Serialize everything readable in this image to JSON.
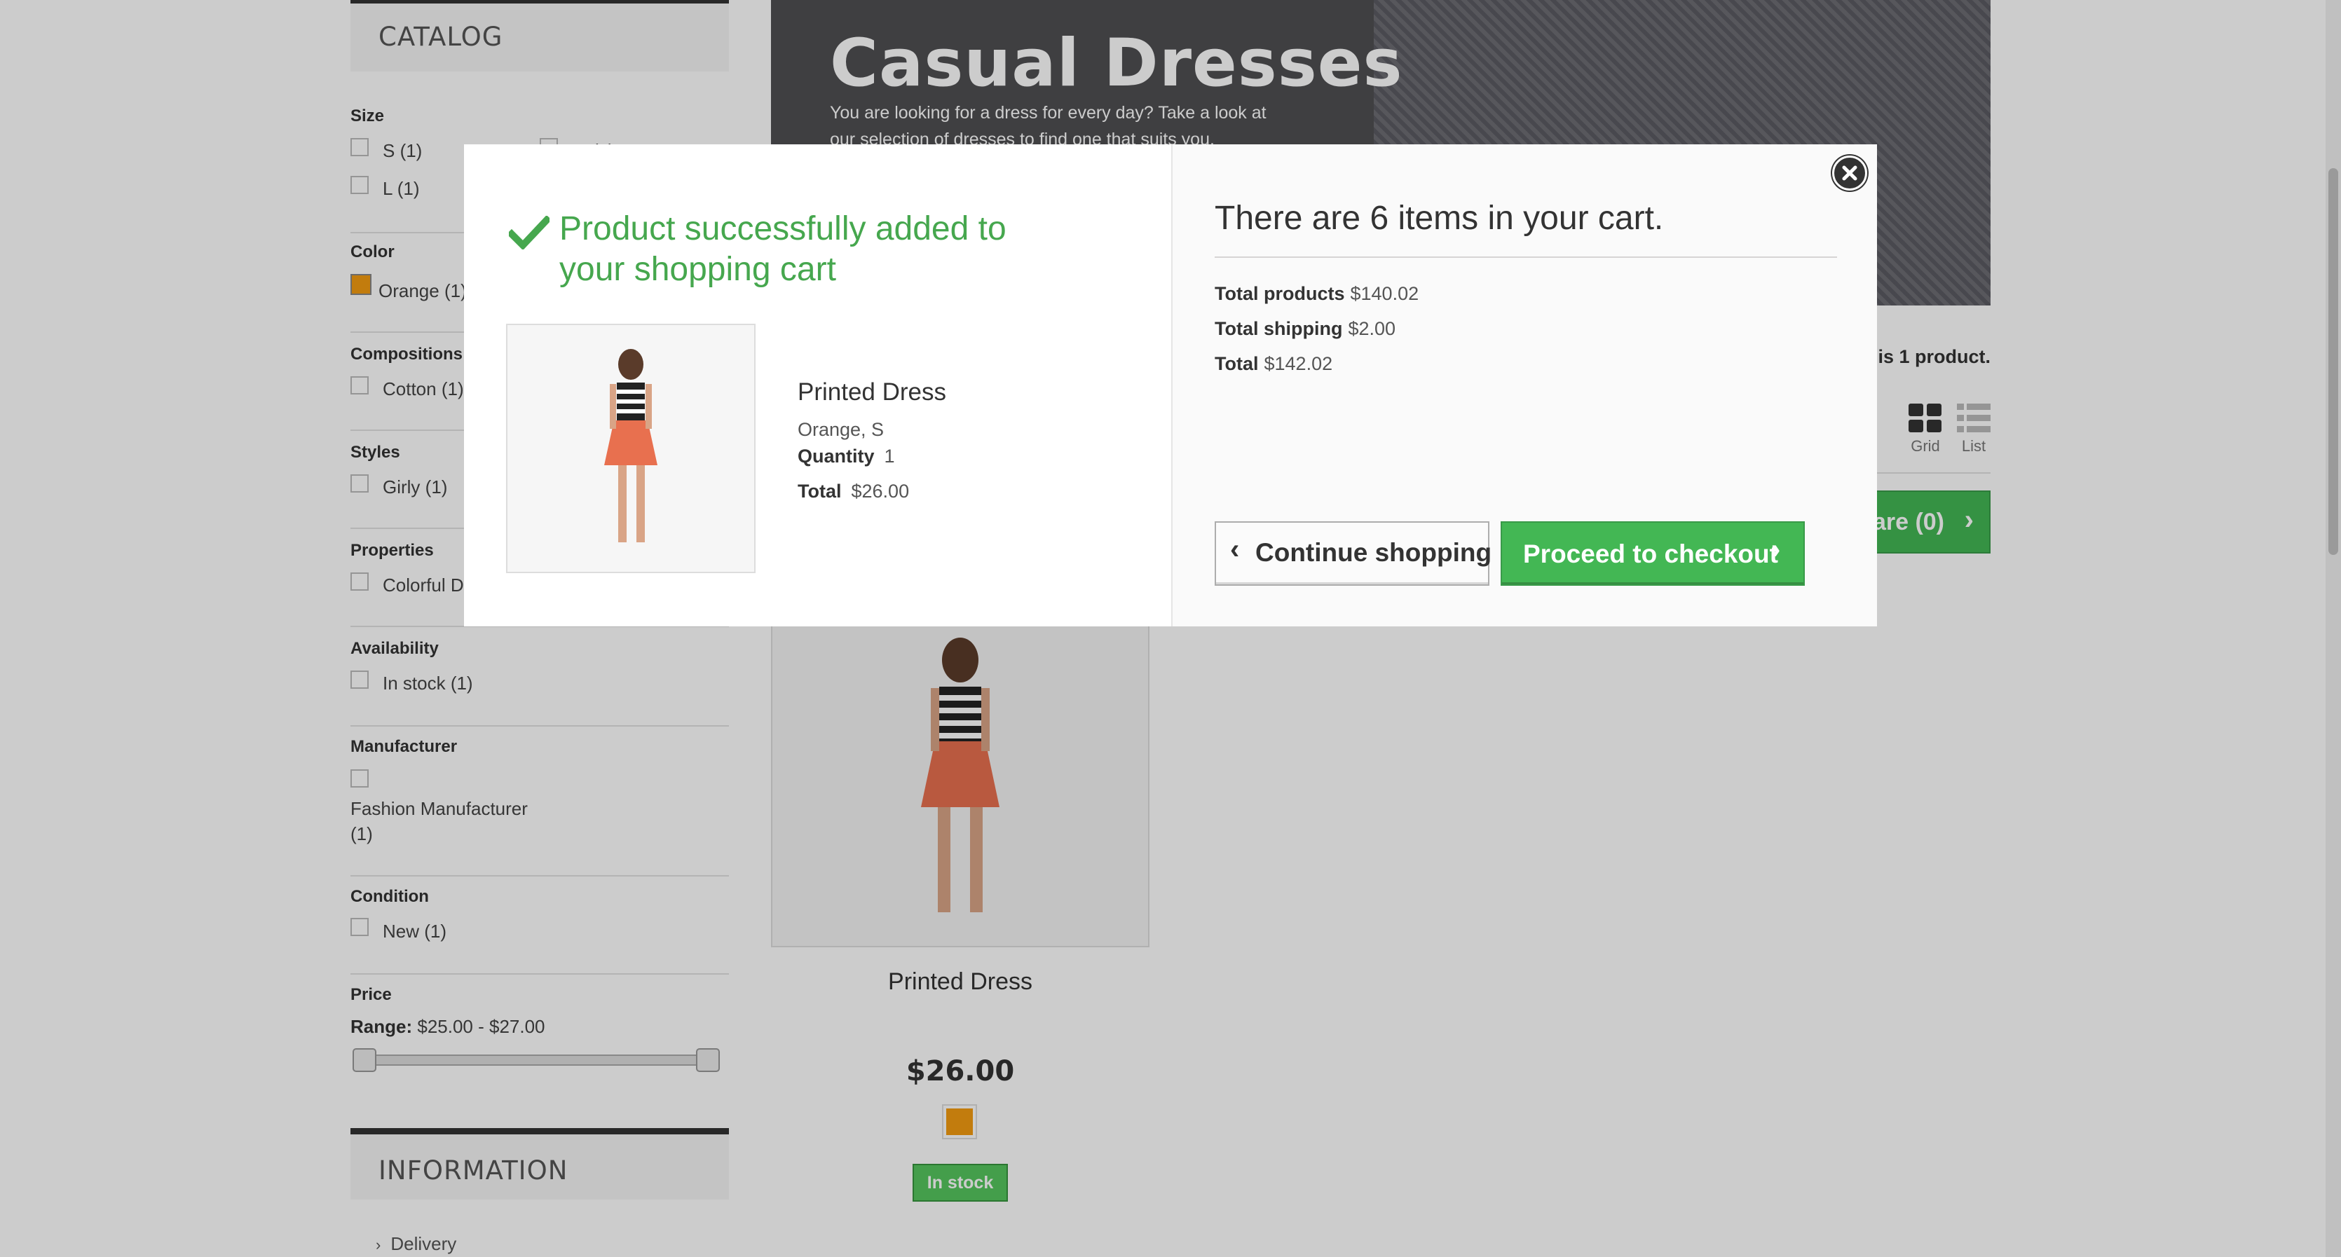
{
  "sidebar": {
    "catalog_title": "CATALOG",
    "size": {
      "title": "Size",
      "options": [
        "S (1)",
        "M (1)",
        "L (1)"
      ]
    },
    "color": {
      "title": "Color",
      "options": [
        "Orange (1)"
      ],
      "swatch": "#f39c11"
    },
    "compositions": {
      "title": "Compositions",
      "options": [
        "Cotton (1)"
      ]
    },
    "styles": {
      "title": "Styles",
      "options": [
        "Girly (1)"
      ]
    },
    "properties": {
      "title": "Properties",
      "options": [
        "Colorful Dress (1)"
      ]
    },
    "availability": {
      "title": "Availability",
      "options": [
        "In stock (1)"
      ]
    },
    "manufacturer": {
      "title": "Manufacturer",
      "option_line1": "Fashion Manufacturer",
      "option_line2": "(1)"
    },
    "condition": {
      "title": "Condition",
      "options": [
        "New (1)"
      ]
    },
    "price": {
      "title": "Price",
      "range_label": "Range:",
      "range_value": "$25.00 - $27.00"
    },
    "information_title": "INFORMATION",
    "info_links": [
      "Delivery"
    ]
  },
  "category": {
    "title": "Casual Dresses",
    "description": "You are looking for a dress for every day? Take a look at our selection of dresses to find one that suits you.",
    "product_count": "There is 1 product.",
    "view_grid": "Grid",
    "view_list": "List",
    "compare_label": "Compare (0)"
  },
  "product": {
    "name": "Printed Dress",
    "price": "$26.00",
    "color_swatch": "#f39c11",
    "stock": "In stock"
  },
  "modal": {
    "success_message": "Product successfully added to your shopping cart",
    "product_name": "Printed Dress",
    "attributes": "Orange, S",
    "quantity_label": "Quantity",
    "quantity_value": "1",
    "total_label": "Total",
    "total_value": "$26.00",
    "cart_summary": "There are 6 items in your cart.",
    "total_products_label": "Total products",
    "total_products_value": "$140.02",
    "total_shipping_label": "Total shipping",
    "total_shipping_value": "$2.00",
    "cart_total_label": "Total",
    "cart_total_value": "$142.02",
    "continue_label": "Continue shopping",
    "checkout_label": "Proceed to checkout"
  },
  "colors": {
    "accent_green": "#43b754",
    "success_text": "#46a74e",
    "orange_swatch": "#f39c11"
  }
}
